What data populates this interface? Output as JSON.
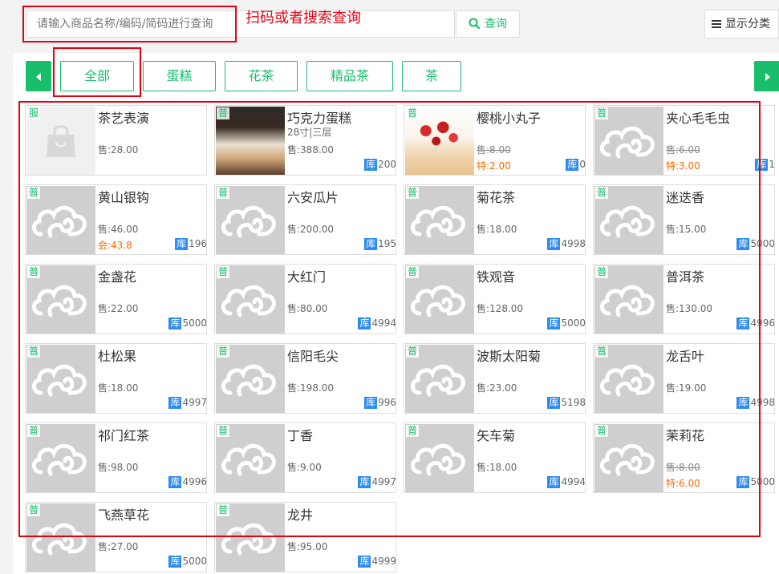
{
  "search": {
    "placeholder": "请输入商品名称/编码/简码进行查询",
    "button_label": "查询",
    "hint": "扫码或者搜索查询"
  },
  "toolbar": {
    "show_category_label": "显示分类"
  },
  "categories": [
    "全部",
    "蛋糕",
    "花茶",
    "精品茶",
    "茶"
  ],
  "products": [
    {
      "badge": "服",
      "name": "茶艺表演",
      "spec": "",
      "price": "售:28.00",
      "special": "",
      "stock": "",
      "image": "bag-icon"
    },
    {
      "badge": "普",
      "name": "巧克力蛋糕",
      "spec": "28寸|三层",
      "price": "售:388.00",
      "special": "",
      "stock": "200",
      "image": "cake-photo"
    },
    {
      "badge": "普",
      "name": "樱桃小丸子",
      "spec": "",
      "price": "售:8.00",
      "special": "特:2.00",
      "stock": "0",
      "image": "cherry-cake-photo"
    },
    {
      "badge": "普",
      "name": "夹心毛毛虫",
      "spec": "",
      "price": "售:6.00",
      "special": "特:3.00",
      "stock": "1",
      "image": "placeholder-logo"
    },
    {
      "badge": "普",
      "name": "黄山银钩",
      "spec": "",
      "price": "售:46.00",
      "special": "会:43.8",
      "stock": "196",
      "image": "placeholder-logo"
    },
    {
      "badge": "普",
      "name": "六安瓜片",
      "spec": "",
      "price": "售:200.00",
      "special": "",
      "stock": "195",
      "image": "placeholder-logo"
    },
    {
      "badge": "普",
      "name": "菊花茶",
      "spec": "",
      "price": "售:18.00",
      "special": "",
      "stock": "4998",
      "image": "placeholder-logo"
    },
    {
      "badge": "普",
      "name": "迷迭香",
      "spec": "",
      "price": "售:15.00",
      "special": "",
      "stock": "5000",
      "image": "placeholder-logo"
    },
    {
      "badge": "普",
      "name": "金盏花",
      "spec": "",
      "price": "售:22.00",
      "special": "",
      "stock": "5000",
      "image": "placeholder-logo"
    },
    {
      "badge": "普",
      "name": "大红门",
      "spec": "",
      "price": "售:80.00",
      "special": "",
      "stock": "4994",
      "image": "placeholder-logo"
    },
    {
      "badge": "普",
      "name": "铁观音",
      "spec": "",
      "price": "售:128.00",
      "special": "",
      "stock": "5000",
      "image": "placeholder-logo"
    },
    {
      "badge": "普",
      "name": "普洱茶",
      "spec": "",
      "price": "售:130.00",
      "special": "",
      "stock": "4996",
      "image": "placeholder-logo"
    },
    {
      "badge": "普",
      "name": "杜松果",
      "spec": "",
      "price": "售:18.00",
      "special": "",
      "stock": "4997",
      "image": "placeholder-logo"
    },
    {
      "badge": "普",
      "name": "信阳毛尖",
      "spec": "",
      "price": "售:198.00",
      "special": "",
      "stock": "996",
      "image": "placeholder-logo"
    },
    {
      "badge": "普",
      "name": "波斯太阳菊",
      "spec": "",
      "price": "售:23.00",
      "special": "",
      "stock": "5198",
      "image": "placeholder-logo"
    },
    {
      "badge": "普",
      "name": "龙舌叶",
      "spec": "",
      "price": "售:19.00",
      "special": "",
      "stock": "4998",
      "image": "placeholder-logo"
    },
    {
      "badge": "普",
      "name": "祁门红茶",
      "spec": "",
      "price": "售:98.00",
      "special": "",
      "stock": "4996",
      "image": "placeholder-logo"
    },
    {
      "badge": "普",
      "name": "丁香",
      "spec": "",
      "price": "售:9.00",
      "special": "",
      "stock": "4997",
      "image": "placeholder-logo"
    },
    {
      "badge": "普",
      "name": "矢车菊",
      "spec": "",
      "price": "售:18.00",
      "special": "",
      "stock": "4994",
      "image": "placeholder-logo"
    },
    {
      "badge": "普",
      "name": "茉莉花",
      "spec": "",
      "price": "售:8.00",
      "special": "特:6.00",
      "stock": "5000",
      "image": "placeholder-logo"
    },
    {
      "badge": "普",
      "name": "飞燕草花",
      "spec": "",
      "price": "售:27.00",
      "special": "",
      "stock": "5000",
      "image": "placeholder-logo"
    },
    {
      "badge": "普",
      "name": "龙井",
      "spec": "",
      "price": "售:95.00",
      "special": "",
      "stock": "4999",
      "image": "placeholder-logo"
    }
  ],
  "stock_label": "库",
  "colors": {
    "accent": "#19be6b",
    "annotation": "#e60012",
    "stock_badge": "#2d8cf0",
    "special_price": "#ff6a00"
  }
}
